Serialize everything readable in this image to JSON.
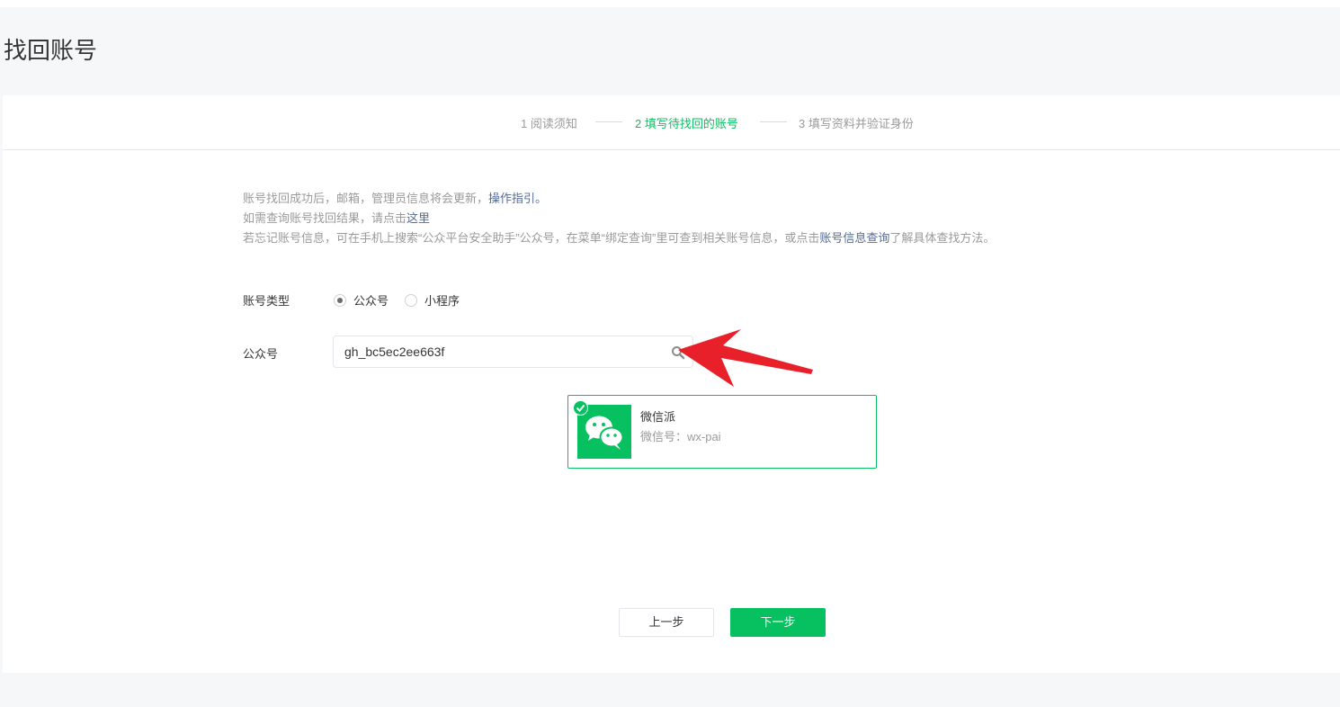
{
  "page": {
    "title": "找回账号"
  },
  "steps": [
    {
      "label": "1 阅读须知"
    },
    {
      "label": "2 填写待找回的账号"
    },
    {
      "label": "3 填写资料并验证身份"
    }
  ],
  "notice": {
    "line1_text": "账号找回成功后，邮箱，管理员信息将会更新，",
    "line1_link": "操作指引。",
    "line2_text": "如需查询账号找回结果，请点击",
    "line2_link": "这里",
    "line3_text": "若忘记账号信息，可在手机上搜索“公众平台安全助手”公众号，在菜单“绑定查询”里可查到相关账号信息，或点击",
    "line3_link": "账号信息查询",
    "line3_suffix": "了解具体查找方法。"
  },
  "form": {
    "account_type_label": "账号类型",
    "radio_options": [
      {
        "label": "公众号",
        "checked": true
      },
      {
        "label": "小程序",
        "checked": false
      }
    ],
    "account_label": "公众号",
    "search_value": "gh_bc5ec2ee663f"
  },
  "result": {
    "name": "微信派",
    "id_line": "微信号：wx-pai",
    "selected": true
  },
  "buttons": {
    "prev": "上一步",
    "next": "下一步"
  },
  "icons": {
    "search": "search-icon",
    "check": "check-icon",
    "avatar": "wechat-icon",
    "arrow": "red-arrow-icon"
  },
  "colors": {
    "accent": "#07c160",
    "link": "#576b95",
    "arrow": "#e8202a"
  }
}
